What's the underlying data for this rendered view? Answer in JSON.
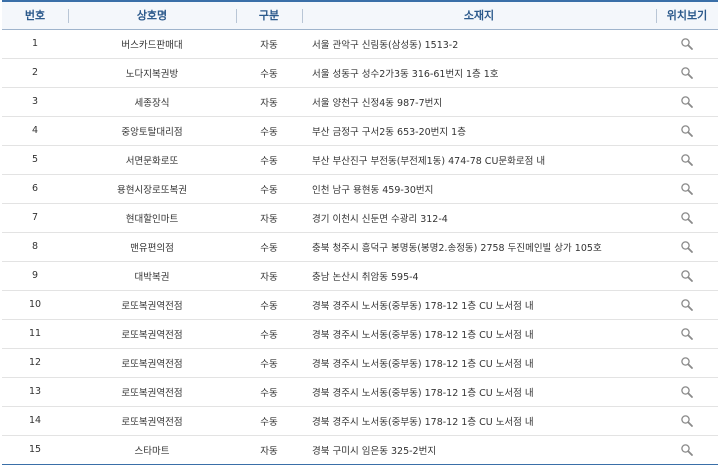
{
  "header": {
    "no": "번호",
    "name": "상호명",
    "type": "구분",
    "address": "소재지",
    "location": "위치보기"
  },
  "rows": [
    {
      "no": "1",
      "name": "버스카드판매대",
      "type": "자동",
      "address": "서울 관악구 신림동(삼성동) 1513-2"
    },
    {
      "no": "2",
      "name": "노다지복권방",
      "type": "수동",
      "address": "서울 성동구 성수2가3동 316-61번지 1층 1호"
    },
    {
      "no": "3",
      "name": "세종장식",
      "type": "자동",
      "address": "서울 양천구 신정4동 987-7번지"
    },
    {
      "no": "4",
      "name": "중앙토탈대리점",
      "type": "수동",
      "address": "부산 금정구 구서2동 653-20번지 1층"
    },
    {
      "no": "5",
      "name": "서면문화로또",
      "type": "수동",
      "address": "부산 부산진구 부전동(부전제1동) 474-78 CU문화로점 내"
    },
    {
      "no": "6",
      "name": "용현시장로또복권",
      "type": "수동",
      "address": "인천 남구 용현동 459-30번지"
    },
    {
      "no": "7",
      "name": "현대할인마트",
      "type": "자동",
      "address": "경기 이천시 신둔면 수광리 312-4"
    },
    {
      "no": "8",
      "name": "맨유편의점",
      "type": "수동",
      "address": "충북 청주시 흥덕구 봉명동(봉명2.송정동) 2758 두진메인빌 상가 105호"
    },
    {
      "no": "9",
      "name": "대박복권",
      "type": "자동",
      "address": "충남 논산시 취암동 595-4"
    },
    {
      "no": "10",
      "name": "로또복권역전점",
      "type": "수동",
      "address": "경북 경주시 노서동(중부동) 178-12 1층 CU 노서점 내"
    },
    {
      "no": "11",
      "name": "로또복권역전점",
      "type": "수동",
      "address": "경북 경주시 노서동(중부동) 178-12 1층 CU 노서점 내"
    },
    {
      "no": "12",
      "name": "로또복권역전점",
      "type": "수동",
      "address": "경북 경주시 노서동(중부동) 178-12 1층 CU 노서점 내"
    },
    {
      "no": "13",
      "name": "로또복권역전점",
      "type": "수동",
      "address": "경북 경주시 노서동(중부동) 178-12 1층 CU 노서점 내"
    },
    {
      "no": "14",
      "name": "로또복권역전점",
      "type": "수동",
      "address": "경북 경주시 노서동(중부동) 178-12 1층 CU 노서점 내"
    },
    {
      "no": "15",
      "name": "스타마트",
      "type": "자동",
      "address": "경북 구미시 임은동 325-2번지"
    }
  ],
  "location_icon": "magnifier-icon",
  "colors": {
    "header_text": "#2c5a8c",
    "header_border": "#3a6fa8",
    "row_divider": "#e3e3e3",
    "icon": "#8a8a8a"
  }
}
